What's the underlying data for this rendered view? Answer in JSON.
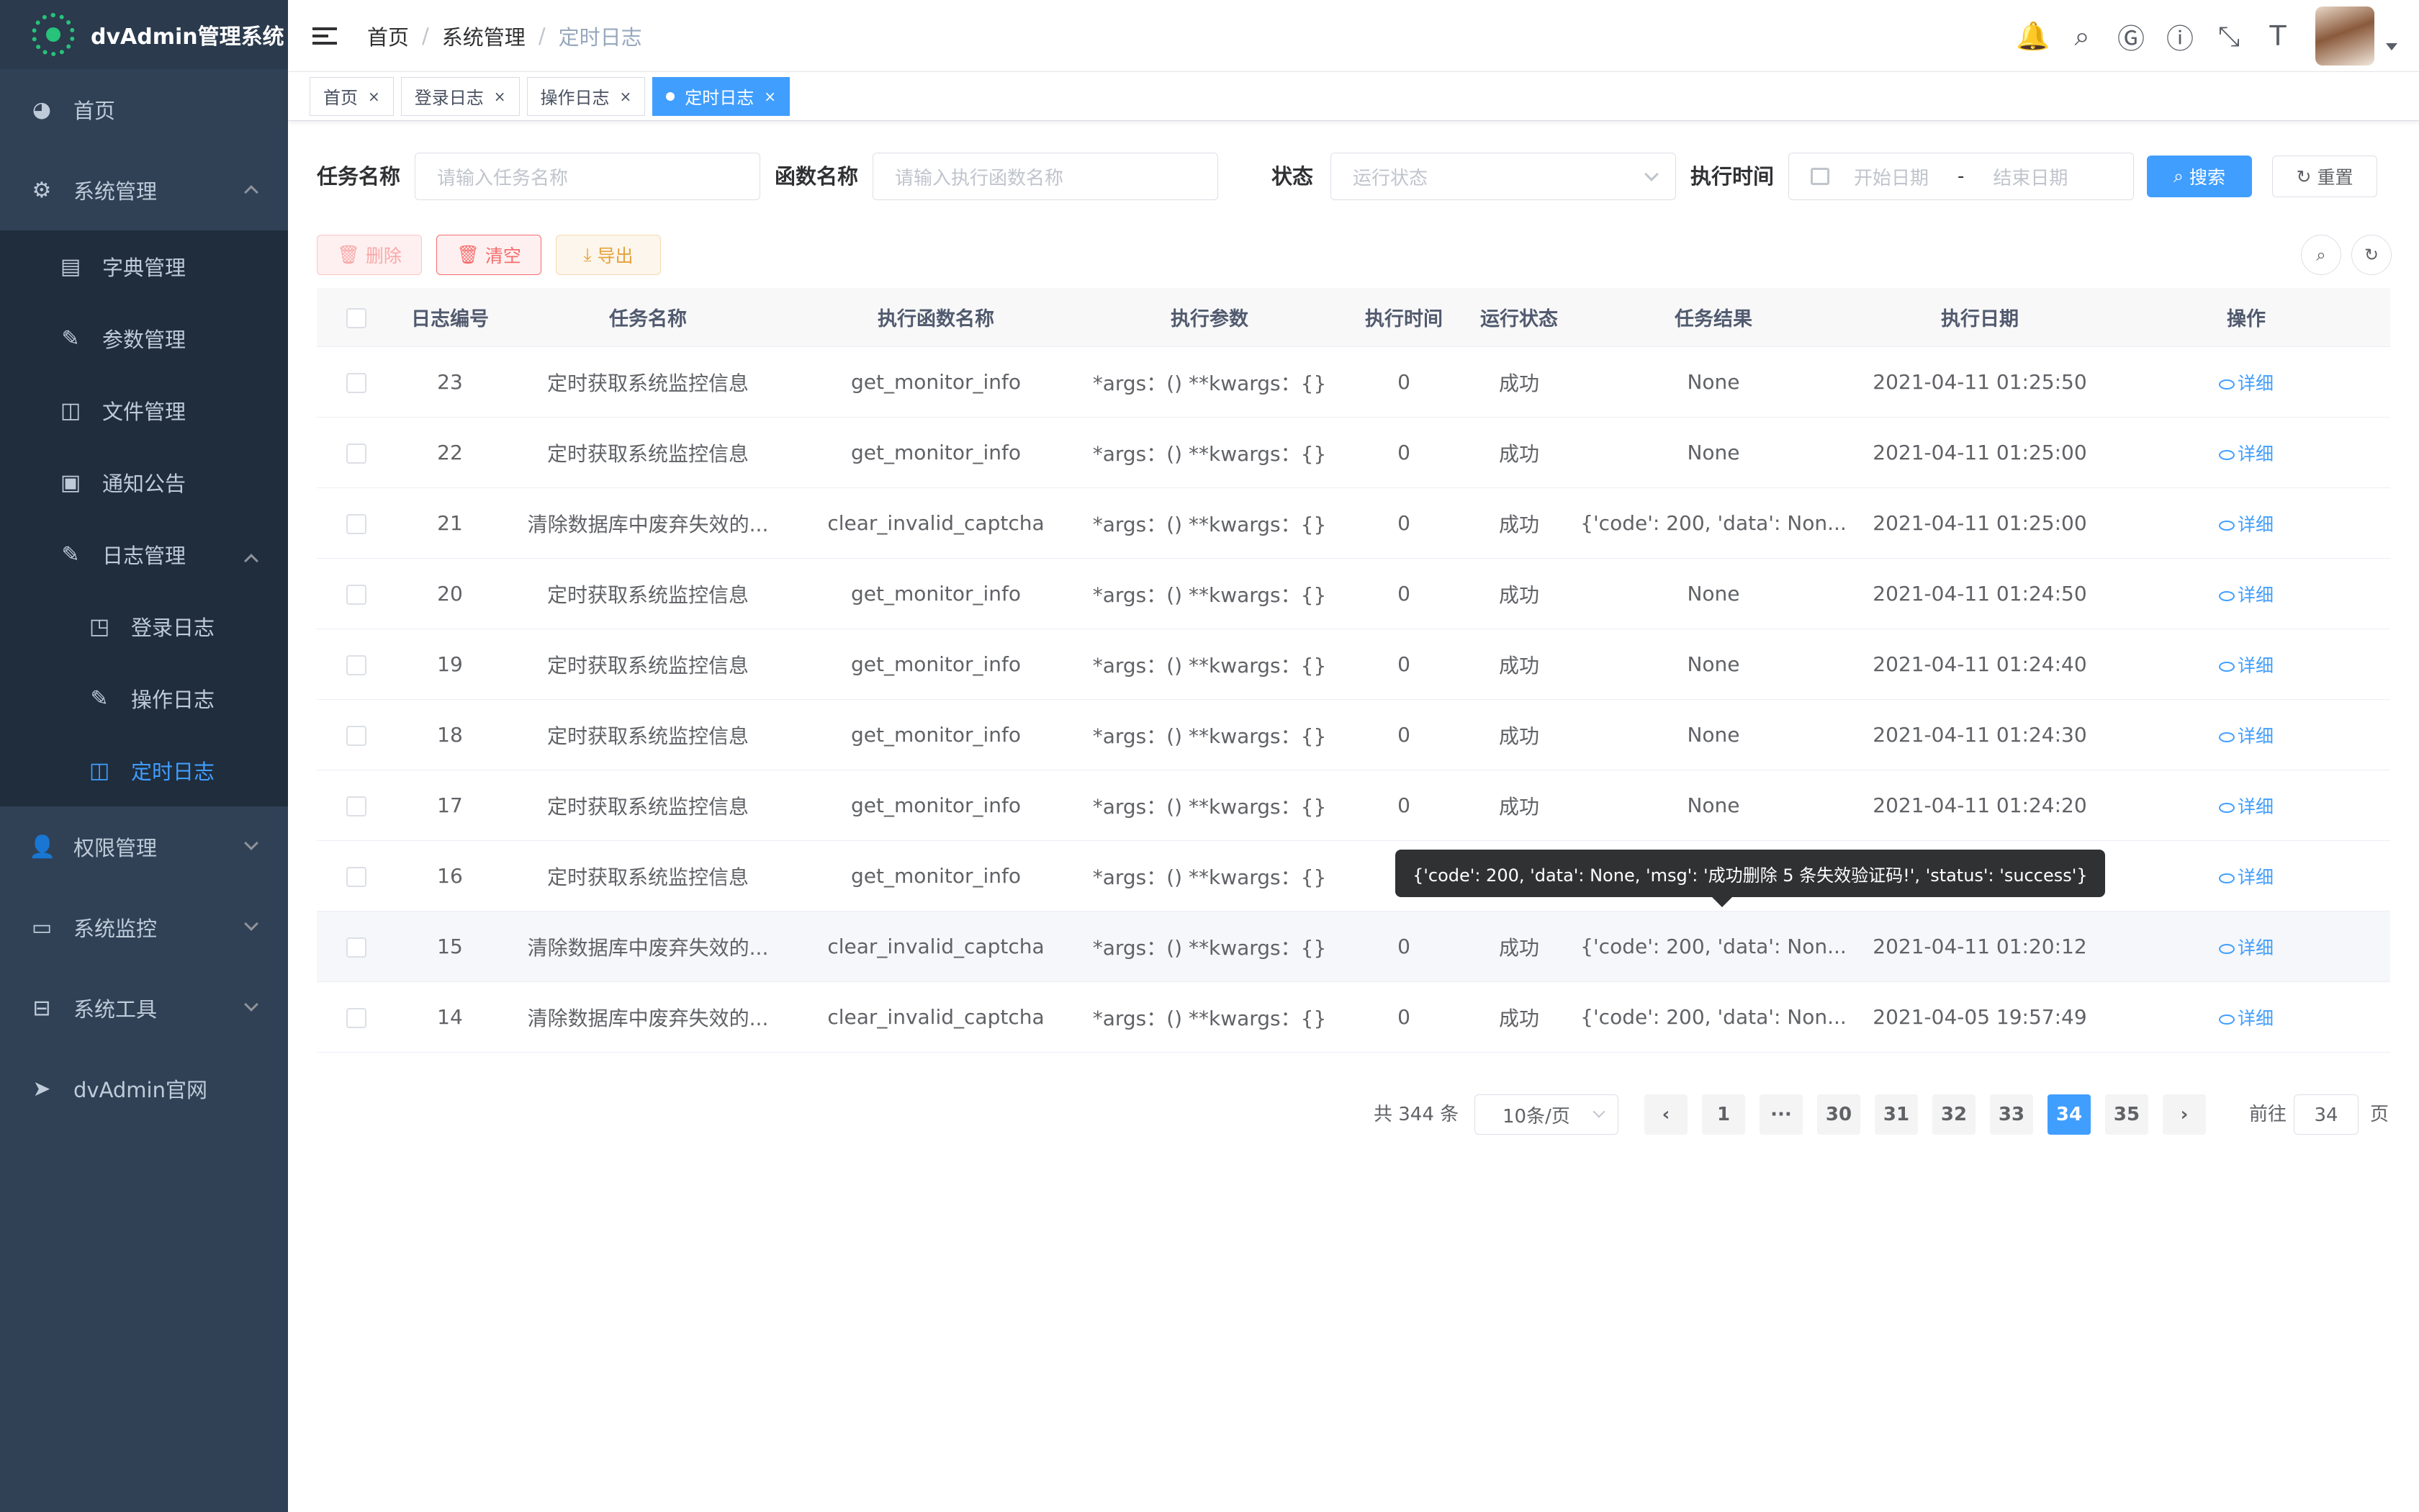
{
  "app": {
    "title": "dvAdmin管理系统"
  },
  "sidebar": {
    "home": "首页",
    "system": "系统管理",
    "dict": "字典管理",
    "params": "参数管理",
    "files": "文件管理",
    "notice": "通知公告",
    "logs": "日志管理",
    "login_log": "登录日志",
    "op_log": "操作日志",
    "timer_log": "定时日志",
    "perm": "权限管理",
    "monitor": "系统监控",
    "tools": "系统工具",
    "official": "dvAdmin官网"
  },
  "breadcrumb": [
    "首页",
    "系统管理",
    "定时日志"
  ],
  "tags": [
    "首页",
    "登录日志",
    "操作日志",
    "定时日志"
  ],
  "search": {
    "task_label": "任务名称",
    "task_placeholder": "请输入任务名称",
    "func_label": "函数名称",
    "func_placeholder": "请输入执行函数名称",
    "status_label": "状态",
    "status_placeholder": "运行状态",
    "time_label": "执行时间",
    "start_placeholder": "开始日期",
    "range_sep": "-",
    "end_placeholder": "结束日期",
    "search_btn": "搜索",
    "reset_btn": "重置"
  },
  "toolbar": {
    "delete": "删除",
    "clear": "清空",
    "export": "导出"
  },
  "table": {
    "headers": [
      "日志编号",
      "任务名称",
      "执行函数名称",
      "执行参数",
      "执行时间",
      "运行状态",
      "任务结果",
      "执行日期",
      "操作"
    ],
    "action_label": "详细",
    "rows": [
      {
        "id": "23",
        "task": "定时获取系统监控信息",
        "func": "get_monitor_info",
        "args": "*args：() **kwargs：{}",
        "time": "0",
        "status": "成功",
        "result": "None",
        "date": "2021-04-11 01:25:50"
      },
      {
        "id": "22",
        "task": "定时获取系统监控信息",
        "func": "get_monitor_info",
        "args": "*args：() **kwargs：{}",
        "time": "0",
        "status": "成功",
        "result": "None",
        "date": "2021-04-11 01:25:00"
      },
      {
        "id": "21",
        "task": "清除数据库中废弃失效的...",
        "func": "clear_invalid_captcha",
        "args": "*args：() **kwargs：{}",
        "time": "0",
        "status": "成功",
        "result": "{'code': 200, 'data': Non...",
        "date": "2021-04-11 01:25:00"
      },
      {
        "id": "20",
        "task": "定时获取系统监控信息",
        "func": "get_monitor_info",
        "args": "*args：() **kwargs：{}",
        "time": "0",
        "status": "成功",
        "result": "None",
        "date": "2021-04-11 01:24:50"
      },
      {
        "id": "19",
        "task": "定时获取系统监控信息",
        "func": "get_monitor_info",
        "args": "*args：() **kwargs：{}",
        "time": "0",
        "status": "成功",
        "result": "None",
        "date": "2021-04-11 01:24:40"
      },
      {
        "id": "18",
        "task": "定时获取系统监控信息",
        "func": "get_monitor_info",
        "args": "*args：() **kwargs：{}",
        "time": "0",
        "status": "成功",
        "result": "None",
        "date": "2021-04-11 01:24:30"
      },
      {
        "id": "17",
        "task": "定时获取系统监控信息",
        "func": "get_monitor_info",
        "args": "*args：() **kwargs：{}",
        "time": "0",
        "status": "成功",
        "result": "None",
        "date": "2021-04-11 01:24:20"
      },
      {
        "id": "16",
        "task": "定时获取系统监控信息",
        "func": "get_monitor_info",
        "args": "*args：() **kwargs：{}",
        "time": "",
        "status": "",
        "result": "",
        "date": "4:10"
      },
      {
        "id": "15",
        "task": "清除数据库中废弃失效的...",
        "func": "clear_invalid_captcha",
        "args": "*args：() **kwargs：{}",
        "time": "0",
        "status": "成功",
        "result": "{'code': 200, 'data': Non...",
        "date": "2021-04-11 01:20:12"
      },
      {
        "id": "14",
        "task": "清除数据库中废弃失效的...",
        "func": "clear_invalid_captcha",
        "args": "*args：() **kwargs：{}",
        "time": "0",
        "status": "成功",
        "result": "{'code': 200, 'data': Non...",
        "date": "2021-04-05 19:57:49"
      }
    ]
  },
  "tooltip": "{'code': 200, 'data': None, 'msg': '成功删除 5 条失效验证码!', 'status': 'success'}",
  "pagination": {
    "total": "共 344 条",
    "page_size": "10条/页",
    "pages": [
      "1",
      "···",
      "30",
      "31",
      "32",
      "33",
      "34",
      "35"
    ],
    "current": "34",
    "goto_label": "前往",
    "goto_value": "34",
    "page_suffix": "页"
  },
  "colors": {
    "sidebar_bg": "#304156",
    "primary": "#409eff",
    "danger": "#f56c6c",
    "warning": "#e6a23c"
  }
}
